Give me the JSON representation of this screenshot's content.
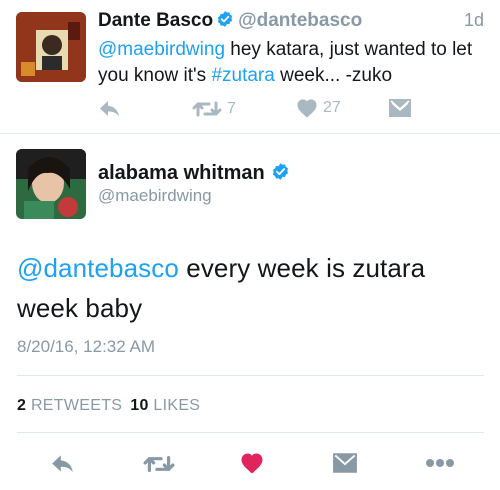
{
  "reply_tweet": {
    "display_name": "Dante Basco",
    "handle": "@dantebasco",
    "time": "1d",
    "mention": "@maebirdwing",
    "text_part1": " hey katara, just wanted to let you know it's ",
    "hashtag": "#zutara",
    "text_part2": " week... -zuko",
    "retweet_count": "7",
    "like_count": "27"
  },
  "main_tweet": {
    "display_name": "alabama whitman",
    "handle": "@maebirdwing",
    "mention": "@dantebasco",
    "text": " every week is zutara week baby",
    "timestamp": "8/20/16, 12:32 AM",
    "retweets_count": "2",
    "retweets_label": "RETWEETS",
    "likes_count": "10",
    "likes_label": "LIKES"
  },
  "colors": {
    "link": "#1da1f2",
    "muted": "#aab8c2",
    "like_active": "#e0245e",
    "verified": "#1da1f2"
  },
  "icons": {
    "reply": "reply-icon",
    "retweet": "retweet-icon",
    "like": "heart-icon",
    "dm": "envelope-icon",
    "more": "more-dots-icon",
    "verified": "verified-badge-icon"
  }
}
